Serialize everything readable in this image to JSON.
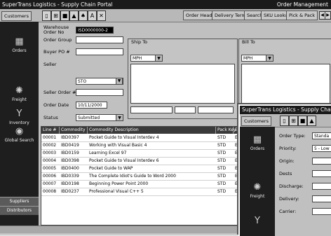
{
  "main_window": {
    "title": "SuperTrans Logistics - Supply Chain Portal",
    "title_right": "Order Management",
    "customer_button": "Customers",
    "tabs": [
      "Order Header",
      "Delivery Terms",
      "Search",
      "SKU Lookup",
      "Pick & Pack"
    ],
    "sidebar": [
      {
        "label": "Orders",
        "icon": "orders-icon",
        "glyph": "▦"
      },
      {
        "label": "Freight",
        "icon": "freight-icon",
        "glyph": "✺"
      },
      {
        "label": "Inventory",
        "icon": "inventory-icon",
        "glyph": "Y"
      },
      {
        "label": "Global Search",
        "icon": "global-search-icon",
        "glyph": "◉"
      }
    ],
    "sidebar_bottom": [
      "Suppliers",
      "Distributors"
    ],
    "form": {
      "warehouse_label": "Warehouse Order No",
      "warehouse_value": "ISD0000000-2",
      "order_group_label": "Order Group",
      "buyer_po_label": "Buyer PO #",
      "seller_label": "Seller",
      "seller_value": "STO",
      "seller_order_label": "Seller Order #",
      "order_date_label": "Order Date",
      "order_date_value": "10/11/2000",
      "status_label": "Status",
      "status_value": "Submitted"
    },
    "ship_to": {
      "title": "Ship To",
      "value": "MPH"
    },
    "bill_to": {
      "title": "Bill To",
      "value": "MPH"
    },
    "grid": {
      "headers": [
        "Line #",
        "Commodity",
        "Commodity Description",
        "Pack Key",
        "E"
      ],
      "rows": [
        {
          "line": "00001",
          "commodity": "IBD0397",
          "desc": "Pocket Guide to Visual Interdev 4",
          "pack": "STD",
          "e": "E"
        },
        {
          "line": "00002",
          "commodity": "IBD0419",
          "desc": "Working with Visual Basic 4",
          "pack": "STD",
          "e": "E"
        },
        {
          "line": "00003",
          "commodity": "IBD0159",
          "desc": "Learning Excel 97",
          "pack": "STD",
          "e": "E"
        },
        {
          "line": "00004",
          "commodity": "IBD0398",
          "desc": "Pocket Guide to Visual Interdev 6",
          "pack": "STD",
          "e": "E"
        },
        {
          "line": "00005",
          "commodity": "IBD0400",
          "desc": "Pocket Guide to WAP",
          "pack": "STD",
          "e": "E"
        },
        {
          "line": "00006",
          "commodity": "IBD0339",
          "desc": "The Complete Idiot's Guide to Word 2000",
          "pack": "STD",
          "e": "E"
        },
        {
          "line": "00007",
          "commodity": "IBD0198",
          "desc": "Beginning Power Point 2000",
          "pack": "STD",
          "e": "E"
        },
        {
          "line": "00008",
          "commodity": "IBD0237",
          "desc": "Professional Visual C++ 5",
          "pack": "STD",
          "e": "E"
        }
      ]
    }
  },
  "second_window": {
    "title": "SuperTrans Logistics - Supply Cha",
    "customer_button": "Customers",
    "fields": [
      {
        "label": "Order Type:",
        "value": "Standa"
      },
      {
        "label": "Priority:",
        "value": "5 - Low"
      },
      {
        "label": "Origin:",
        "value": ""
      },
      {
        "label": "Dests",
        "value": ""
      },
      {
        "label": "Discharge:",
        "value": ""
      },
      {
        "label": "Delivery:",
        "value": ""
      },
      {
        "label": "Carrier:",
        "value": ""
      }
    ],
    "sidebar": [
      {
        "label": "Orders",
        "icon": "orders-icon",
        "glyph": "▦"
      },
      {
        "label": "Freight",
        "icon": "freight-icon",
        "glyph": "✺"
      },
      {
        "label": "",
        "icon": "inventory-icon",
        "glyph": "Y"
      }
    ]
  }
}
